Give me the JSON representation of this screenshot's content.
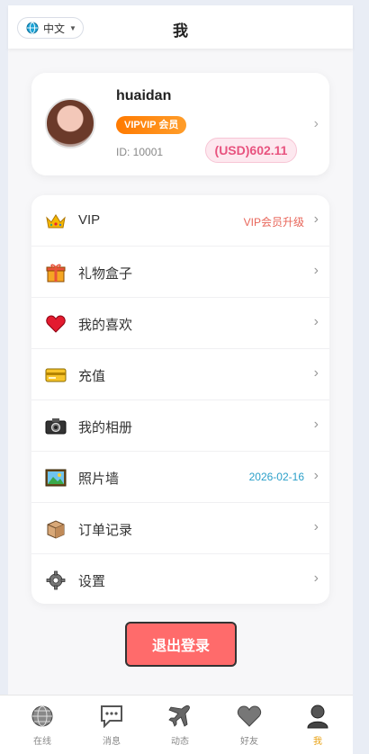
{
  "header": {
    "language": "中文",
    "title": "我"
  },
  "profile": {
    "username": "huaidan",
    "vip_badge": "VIPVIP 会员",
    "id_text": "ID: 10001",
    "balance": "(USD)602.11"
  },
  "menu": [
    {
      "label": "VIP",
      "extra": "VIP会员升级",
      "extra_color": "#e8665a",
      "icon": "crown-icon"
    },
    {
      "label": "礼物盒子",
      "extra": "",
      "icon": "gift-icon"
    },
    {
      "label": "我的喜欢",
      "extra": "",
      "icon": "heart-icon"
    },
    {
      "label": "充值",
      "extra": "",
      "icon": "credit-card-icon"
    },
    {
      "label": "我的相册",
      "extra": "",
      "icon": "camera-icon"
    },
    {
      "label": "照片墙",
      "extra": "2026-02-16",
      "extra_color": "#2a9fc9",
      "icon": "picture-icon"
    },
    {
      "label": "订单记录",
      "extra": "",
      "icon": "package-icon"
    },
    {
      "label": "设置",
      "extra": "",
      "icon": "gear-icon"
    }
  ],
  "logout_label": "退出登录",
  "bottom_nav": [
    {
      "label": "在线",
      "icon": "globe-icon"
    },
    {
      "label": "消息",
      "icon": "chat-bubble-icon"
    },
    {
      "label": "动态",
      "icon": "airplane-icon"
    },
    {
      "label": "好友",
      "icon": "heart-icon"
    },
    {
      "label": "我",
      "icon": "person-icon",
      "active": true
    }
  ],
  "colors": {
    "accent_orange": "#ff8a14",
    "balance_pink": "#e8537f",
    "logout_red": "#ff6b6b",
    "active_nav": "#e8a010"
  }
}
